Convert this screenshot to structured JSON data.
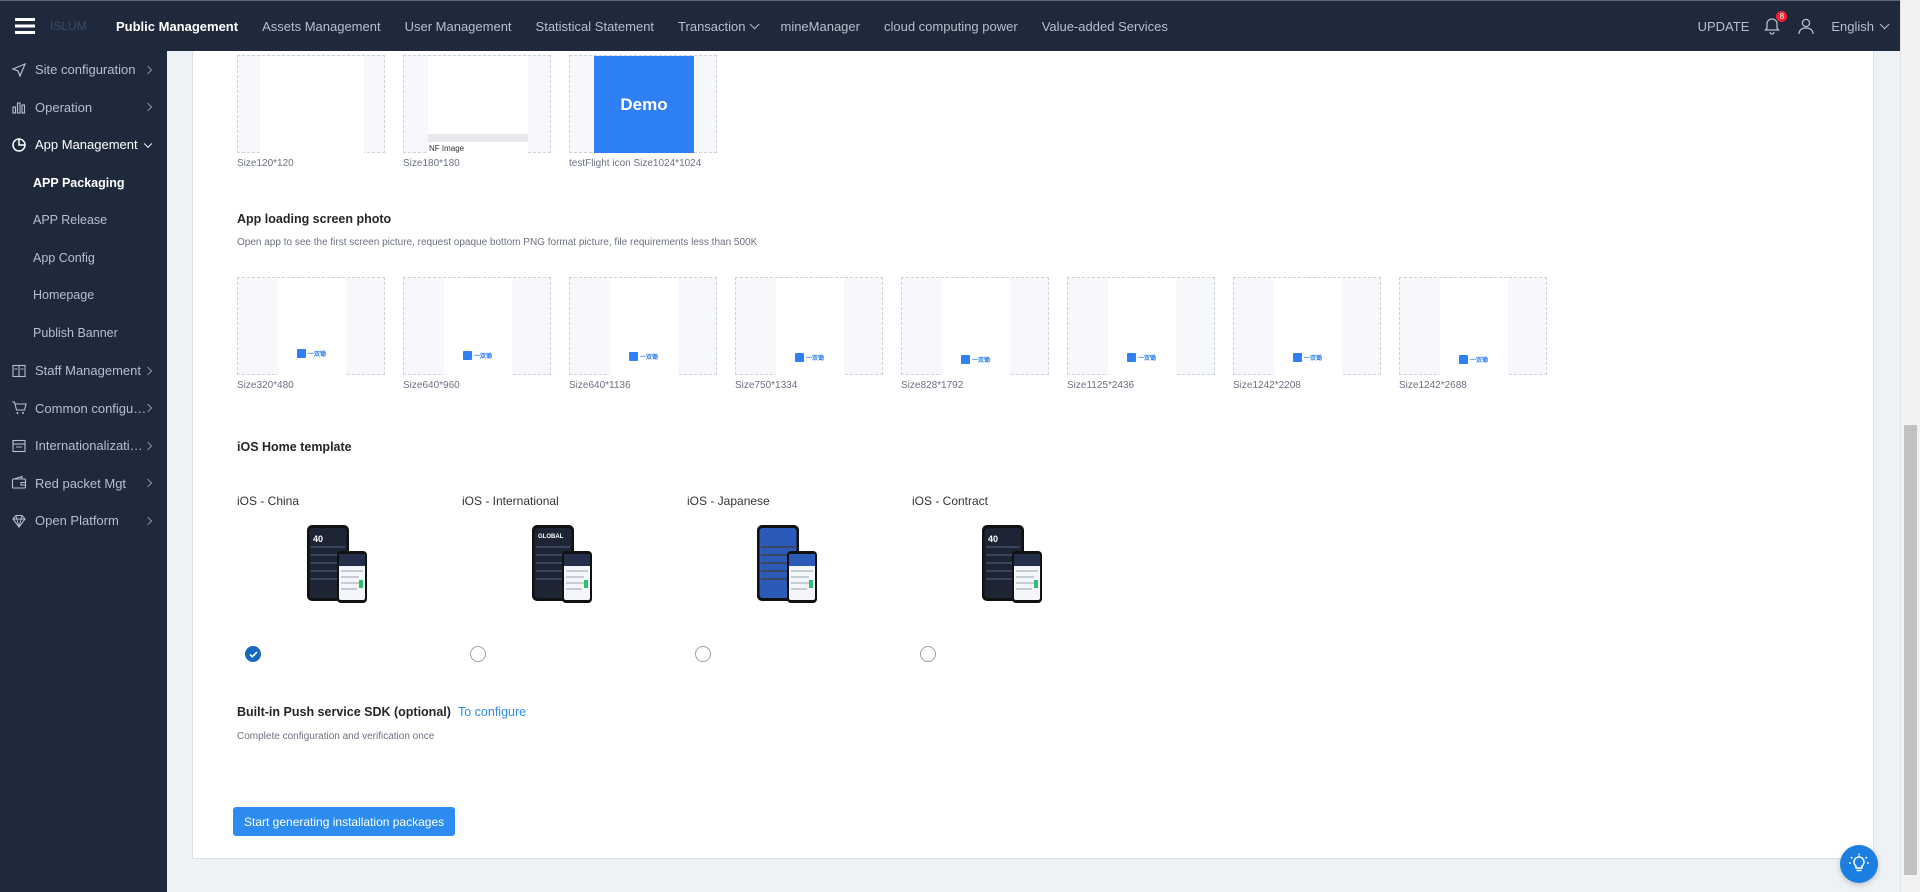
{
  "topbar": {
    "logo_text": "ISLUM",
    "nav": [
      {
        "label": "Public Management",
        "active": true
      },
      {
        "label": "Assets Management"
      },
      {
        "label": "User Management"
      },
      {
        "label": "Statistical Statement"
      },
      {
        "label": "Transaction",
        "dropdown": true
      },
      {
        "label": "mineManager"
      },
      {
        "label": "cloud computing power"
      },
      {
        "label": "Value-added Services"
      }
    ],
    "update_label": "UPDATE",
    "notification_count": "8",
    "language": "English"
  },
  "sidebar": {
    "items": [
      {
        "label": "Site configuration",
        "icon": "send-icon"
      },
      {
        "label": "Operation",
        "icon": "bar-chart-icon"
      },
      {
        "label": "App Management",
        "icon": "app-icon",
        "open": true
      },
      {
        "label": "Staff Management",
        "icon": "book-icon"
      },
      {
        "label": "Common configura...",
        "icon": "cart-icon"
      },
      {
        "label": "Internationalization...",
        "icon": "window-icon"
      },
      {
        "label": "Red packet Mgt",
        "icon": "wallet-icon"
      },
      {
        "label": "Open Platform",
        "icon": "diamond-icon"
      }
    ],
    "sub_items": [
      {
        "label": "APP Packaging",
        "active": true
      },
      {
        "label": "APP Release"
      },
      {
        "label": "App Config"
      },
      {
        "label": "Homepage"
      },
      {
        "label": "Publish Banner"
      }
    ]
  },
  "icons_row": {
    "captions": [
      "Size120*120",
      "Size180*180",
      "testFlight icon Size1024*1024"
    ],
    "demo_text": "Demo",
    "nf_text": "NF Image"
  },
  "loading": {
    "title": "App loading screen photo",
    "desc": "Open app to see the first screen picture, request opaque bottom PNG format picture, file requirements less than 500K",
    "logo_text": "一双锄",
    "sizes": [
      "Size320*480",
      "Size640*960",
      "Size640*1136",
      "Size750*1334",
      "Size828*1792",
      "Size1125*2436",
      "Size1242*2208",
      "Size1242*2688"
    ]
  },
  "templates": {
    "title": "iOS   Home template",
    "items": [
      {
        "label": "iOS - China",
        "checked": true,
        "screen_text": "40"
      },
      {
        "label": "iOS - International",
        "checked": false,
        "screen_text": "GLOBAL"
      },
      {
        "label": "iOS - Japanese",
        "checked": false,
        "screen_text": ""
      },
      {
        "label": "iOS - Contract",
        "checked": false,
        "screen_text": "40"
      }
    ]
  },
  "push": {
    "title": "Built-in Push service SDK (optional)",
    "link": "To configure",
    "desc": "Complete configuration and verification once"
  },
  "actions": {
    "generate_label": "Start generating installation packages"
  },
  "colors": {
    "sidebar_bg": "#1e2a3b",
    "accent": "#2d8cf0",
    "radio_checked": "#1867c0"
  }
}
